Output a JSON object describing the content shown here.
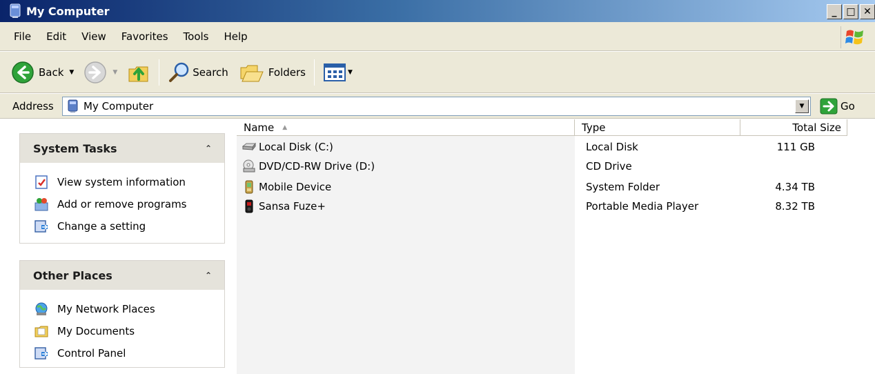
{
  "window": {
    "title": "My Computer",
    "buttons": {
      "minimize": "_",
      "maximize": "□",
      "close": "✕"
    }
  },
  "menu": [
    "File",
    "Edit",
    "View",
    "Favorites",
    "Tools",
    "Help"
  ],
  "toolbar": {
    "back_label": "Back",
    "search_label": "Search",
    "folders_label": "Folders"
  },
  "address": {
    "label": "Address",
    "value": "My Computer",
    "go_label": "Go"
  },
  "system_tasks": {
    "header": "System Tasks",
    "items": [
      {
        "label": "View system information",
        "icon": "system-info-icon"
      },
      {
        "label": "Add or remove programs",
        "icon": "add-remove-programs-icon"
      },
      {
        "label": "Change a setting",
        "icon": "control-panel-icon"
      }
    ]
  },
  "other_places": {
    "header": "Other Places",
    "items": [
      {
        "label": "My Network Places",
        "icon": "network-places-icon"
      },
      {
        "label": "My Documents",
        "icon": "documents-folder-icon"
      },
      {
        "label": "Control Panel",
        "icon": "control-panel-icon"
      }
    ]
  },
  "file_list": {
    "columns": {
      "name": "Name",
      "type": "Type",
      "size": "Total Size"
    },
    "rows": [
      {
        "name": "Local Disk (C:)",
        "type": "Local Disk",
        "size": "111 GB",
        "icon": "hard-disk-icon"
      },
      {
        "name": "DVD/CD-RW Drive (D:)",
        "type": "CD Drive",
        "size": "",
        "icon": "cd-drive-icon"
      },
      {
        "name": "Mobile Device",
        "type": "System Folder",
        "size": "4.34 TB",
        "icon": "mobile-device-icon"
      },
      {
        "name": "Sansa Fuze+",
        "type": "Portable Media Player",
        "size": "8.32 TB",
        "icon": "media-player-icon"
      }
    ]
  }
}
